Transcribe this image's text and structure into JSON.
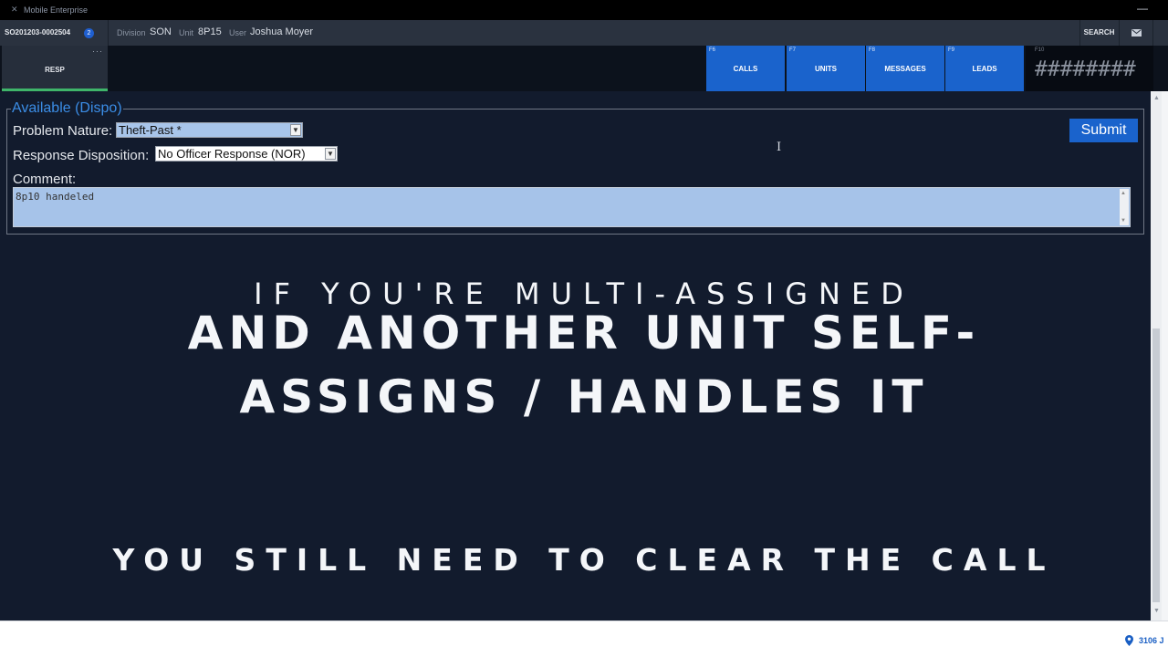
{
  "titlebar": {
    "title": "Mobile Enterprise",
    "minimize_glyph": "—"
  },
  "infobar": {
    "incident_id": "SO201203-0002504",
    "badge": "2",
    "division_label": "Division",
    "division_value": "SON",
    "unit_label": "Unit",
    "unit_value": "8P15",
    "user_label": "User",
    "user_value": "Joshua Moyer",
    "search_label": "SEARCH"
  },
  "nav": {
    "resp_label": "RESP",
    "resp_menu": "···",
    "fkeys": [
      {
        "key": "F6",
        "label": "CALLS"
      },
      {
        "key": "F7",
        "label": "UNITS"
      },
      {
        "key": "F8",
        "label": "MESSAGES"
      },
      {
        "key": "F9",
        "label": "LEADS"
      }
    ],
    "blank_key": "F10",
    "blank_value": "########"
  },
  "form": {
    "legend": "Available (Dispo)",
    "problem_label": "Problem Nature:",
    "problem_value": "Theft-Past *",
    "disposition_label": "Response Disposition:",
    "disposition_value": "No Officer Response (NOR)",
    "comment_label": "Comment:",
    "comment_value": "8p10 handeled",
    "submit_label": "Submit"
  },
  "overlay": {
    "line1": "IF YOU'RE MULTI-ASSIGNED",
    "line2": "AND ANOTHER UNIT SELF-",
    "line3": "ASSIGNS / HANDLES IT",
    "line4": "YOU STILL NEED TO CLEAR THE CALL"
  },
  "status": {
    "address": "3106 J"
  },
  "colors": {
    "accent_blue": "#1a63cc",
    "active_green": "#3fb56a",
    "legend_blue": "#3b8de6",
    "background": "#121b2d"
  },
  "icons": [
    "app-icon",
    "mail-icon",
    "location-pin-icon",
    "chevron-down-icon",
    "text-cursor-icon"
  ]
}
